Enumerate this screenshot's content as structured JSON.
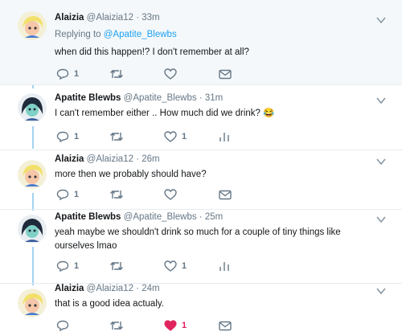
{
  "icons": {
    "reply": "reply-icon",
    "retweet": "retweet-icon",
    "like": "heart-icon",
    "like_active": "heart-filled-icon",
    "message": "envelope-icon",
    "analytics": "analytics-icon",
    "more": "caret-down-icon"
  },
  "colors": {
    "link": "#1da1f2",
    "muted": "#657786",
    "like_active": "#e0245e",
    "thread_line": "#a3d2f0",
    "highlight_bg": "#f5f8fa"
  },
  "tweets": [
    {
      "name": "Alaizia",
      "handle": "@Alaizia12",
      "separator": "·",
      "time": "33m",
      "replying_prefix": "Replying to",
      "replying_to": "@Apatite_Blewbs",
      "text": "when did this happen!? I don't remember at all?",
      "reply_count": "1",
      "like_count": ""
    },
    {
      "name": "Apatite Blewbs",
      "handle": "@Apatite_Blewbs",
      "separator": "·",
      "time": "31m",
      "text": "I can't remember either .. How much did we drink? 😂",
      "reply_count": "1",
      "like_count": "1"
    },
    {
      "name": "Alaizia",
      "handle": "@Alaizia12",
      "separator": "·",
      "time": "26m",
      "text": "more then we probably should have?",
      "reply_count": "1",
      "like_count": ""
    },
    {
      "name": "Apatite Blewbs",
      "handle": "@Apatite_Blewbs",
      "separator": "·",
      "time": "25m",
      "text": "yeah maybe we shouldn't drink so much for a couple of tiny things like ourselves lmao",
      "reply_count": "1",
      "like_count": "1"
    },
    {
      "name": "Alaizia",
      "handle": "@Alaizia12",
      "separator": "·",
      "time": "24m",
      "text": "that is a good idea actualy.",
      "reply_count": "",
      "like_count": "1",
      "liked": true
    }
  ]
}
